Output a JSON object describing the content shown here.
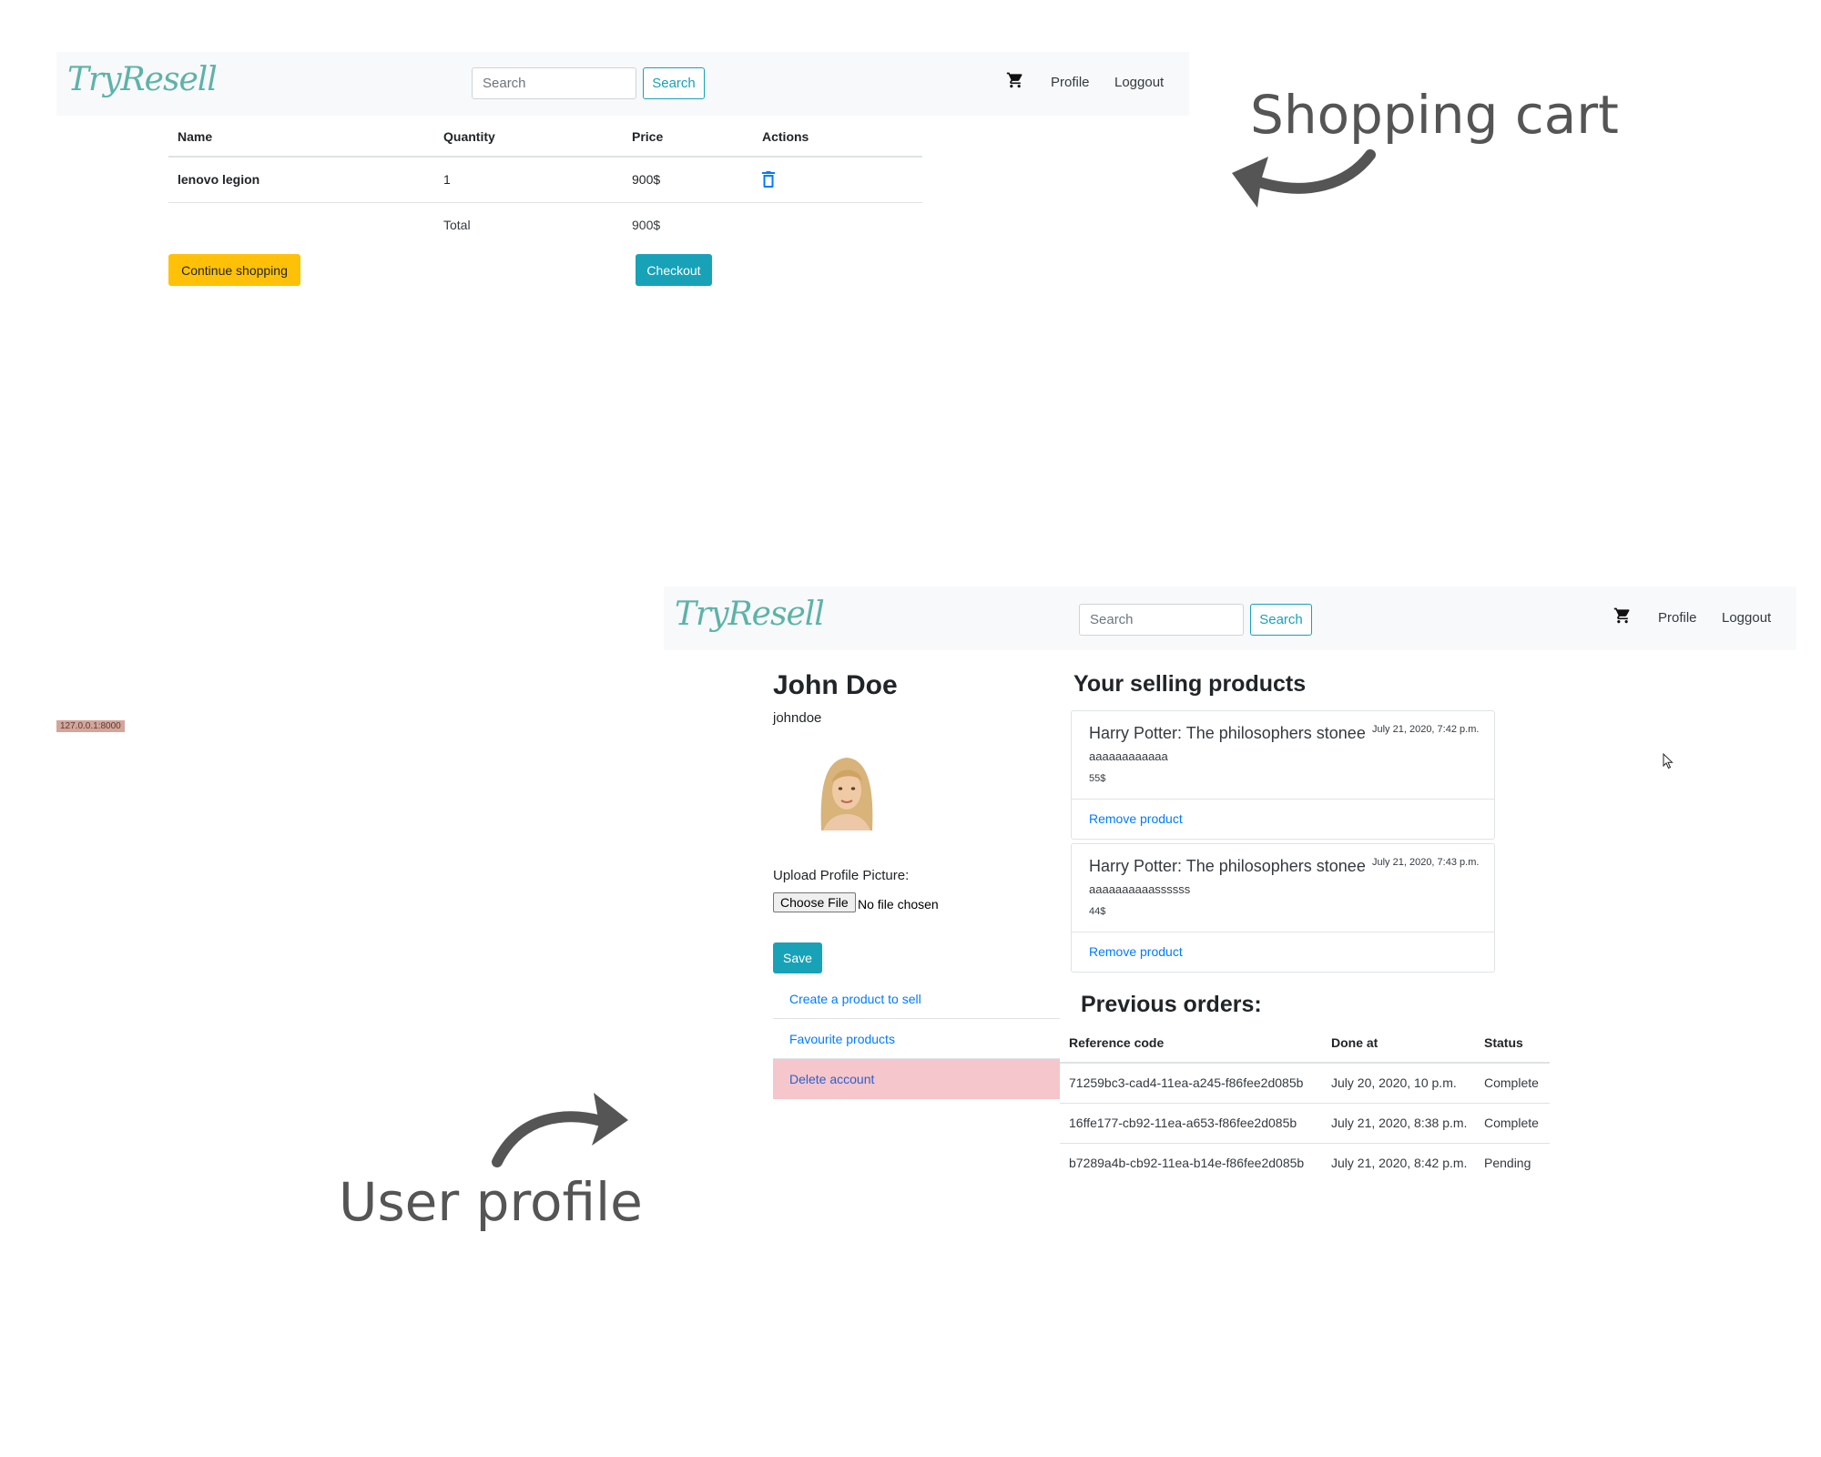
{
  "brand": "TryResell",
  "annotations": {
    "shopping_cart": "Shopping cart",
    "user_profile": "User profile",
    "url_badge": "127.0.0.1:8000"
  },
  "navbar": {
    "search_placeholder": "Search",
    "search_button": "Search",
    "cart_icon": "cart-icon",
    "profile_link": "Profile",
    "logout_link": "Loggout"
  },
  "cart": {
    "columns": [
      "Name",
      "Quantity",
      "Price",
      "Actions"
    ],
    "items": [
      {
        "name": "lenovo legion",
        "quantity": "1",
        "price": "900$",
        "action_icon": "trash-icon"
      }
    ],
    "total_label": "Total",
    "total_value": "900$",
    "continue_button": "Continue shopping",
    "checkout_button": "Checkout"
  },
  "profile": {
    "name": "John Doe",
    "username": "johndoe",
    "upload_label": "Upload Profile Picture:",
    "choose_file": "Choose File",
    "file_status": "No file chosen",
    "save_button": "Save",
    "links": {
      "create": "Create a product to sell",
      "favourite": "Favourite products",
      "delete": "Delete account"
    }
  },
  "selling": {
    "title": "Your selling products",
    "products": [
      {
        "title": "Harry Potter: The philosophers stonee",
        "date": "July 21, 2020, 7:42 p.m.",
        "description": "aaaaaaaaaaaa",
        "price": "55$",
        "remove": "Remove product"
      },
      {
        "title": "Harry Potter: The philosophers stonee",
        "date": "July 21, 2020, 7:43 p.m.",
        "description": "aaaaaaaaaassssss",
        "price": "44$",
        "remove": "Remove product"
      }
    ]
  },
  "orders": {
    "title": "Previous orders:",
    "columns": [
      "Reference code",
      "Done at",
      "Status"
    ],
    "rows": [
      {
        "ref": "71259bc3-cad4-11ea-a245-f86fee2d085b",
        "done_at": "July 20, 2020, 10 p.m.",
        "status": "Complete"
      },
      {
        "ref": "16ffe177-cb92-11ea-a653-f86fee2d085b",
        "done_at": "July 21, 2020, 8:38 p.m.",
        "status": "Complete"
      },
      {
        "ref": "b7289a4b-cb92-11ea-b14e-f86fee2d085b",
        "done_at": "July 21, 2020, 8:42 p.m.",
        "status": "Pending"
      }
    ]
  },
  "colors": {
    "brand": "#5db3a8",
    "info": "#17a2b8",
    "warning": "#ffc107",
    "danger_bg": "#f5c6cb",
    "link": "#007bff",
    "annotation": "#555555"
  }
}
